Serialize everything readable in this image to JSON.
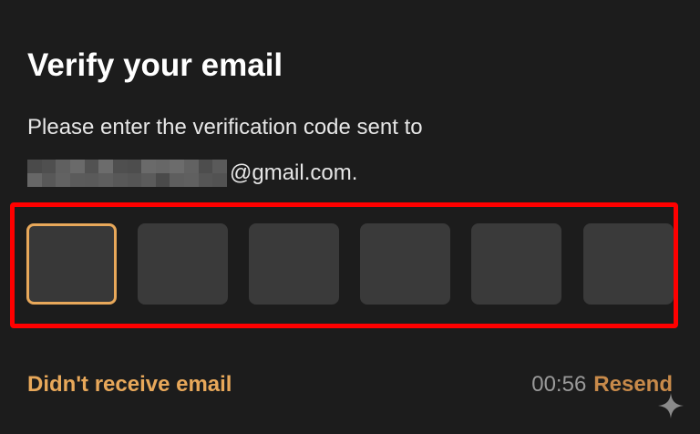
{
  "screen": {
    "title": "Verify your email",
    "subtitle": "Please enter the verification code sent to",
    "email_domain": "@gmail.com."
  },
  "code_input": {
    "boxes": [
      "",
      "",
      "",
      "",
      "",
      ""
    ],
    "active_index": 0
  },
  "footer": {
    "didnt_receive_label": "Didn't receive email",
    "timer": "00:56",
    "resend_label": "Resend"
  },
  "colors": {
    "background": "#1c1c1c",
    "accent": "#e8a85a",
    "box_fill": "#3a3a3a",
    "highlight": "#ff0000"
  },
  "icons": {
    "corner": "sparkle-icon"
  }
}
